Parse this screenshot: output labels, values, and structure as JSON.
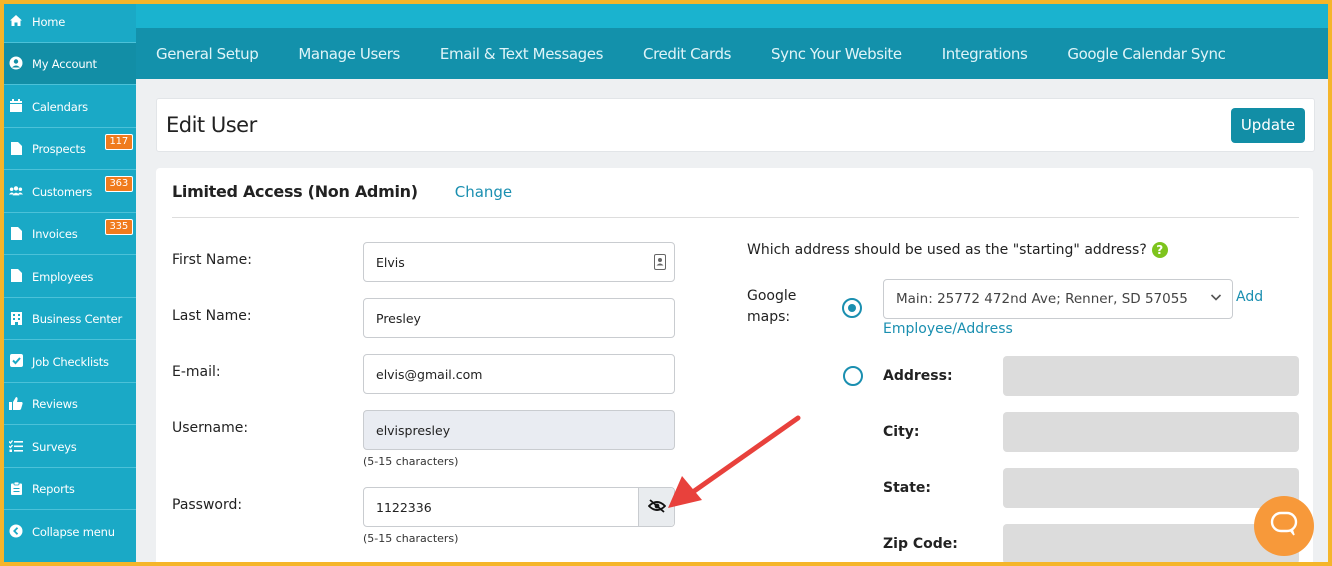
{
  "sidebar": {
    "items": [
      {
        "label": "Home",
        "icon": "home-icon"
      },
      {
        "label": "My Account",
        "icon": "user-circle-icon"
      },
      {
        "label": "Calendars",
        "icon": "calendar-icon"
      },
      {
        "label": "Prospects",
        "icon": "file-icon",
        "badge": "117"
      },
      {
        "label": "Customers",
        "icon": "users-icon",
        "badge": "363"
      },
      {
        "label": "Invoices",
        "icon": "file-icon",
        "badge": "335"
      },
      {
        "label": "Employees",
        "icon": "file-icon"
      },
      {
        "label": "Business Center",
        "icon": "building-icon"
      },
      {
        "label": "Job Checklists",
        "icon": "checkbox-icon"
      },
      {
        "label": "Reviews",
        "icon": "thumbs-up-icon"
      },
      {
        "label": "Surveys",
        "icon": "list-check-icon"
      },
      {
        "label": "Reports",
        "icon": "clipboard-icon"
      },
      {
        "label": "Collapse menu",
        "icon": "chevron-left-circle-icon"
      }
    ]
  },
  "nav": {
    "items": [
      "General Setup",
      "Manage Users",
      "Email & Text Messages",
      "Credit Cards",
      "Sync Your Website",
      "Integrations",
      "Google Calendar Sync"
    ]
  },
  "header": {
    "title": "Edit User",
    "update_label": "Update"
  },
  "form": {
    "access_title": "Limited Access (Non Admin)",
    "change_label": "Change",
    "first_name_label": "First Name:",
    "first_name_value": "Elvis",
    "last_name_label": "Last Name:",
    "last_name_value": "Presley",
    "email_label": "E-mail:",
    "email_value": "elvis@gmail.com",
    "username_label": "Username:",
    "username_value": "elvispresley",
    "username_hint": "(5-15 characters)",
    "password_label": "Password:",
    "password_value": "1122336",
    "password_hint": "(5-15 characters)"
  },
  "address": {
    "question": "Which address should be used as the \"starting\" address?",
    "help": "?",
    "google_maps_label_1": "Google",
    "google_maps_label_2": "maps:",
    "selected_address": "Main: 25772 472nd Ave; Renner, SD 57055",
    "add_label_1": "Add",
    "add_label_2": "Employee/Address",
    "address_label": "Address:",
    "city_label": "City:",
    "state_label": "State:",
    "zip_label": "Zip Code:"
  },
  "colors": {
    "sidebar": "#1aa9c6",
    "navbar": "#1391ab",
    "accent": "#128ea6",
    "badge": "#f07b1d",
    "chat": "#f7993a",
    "frame": "#f5b52a",
    "arrow": "#e8413c"
  }
}
